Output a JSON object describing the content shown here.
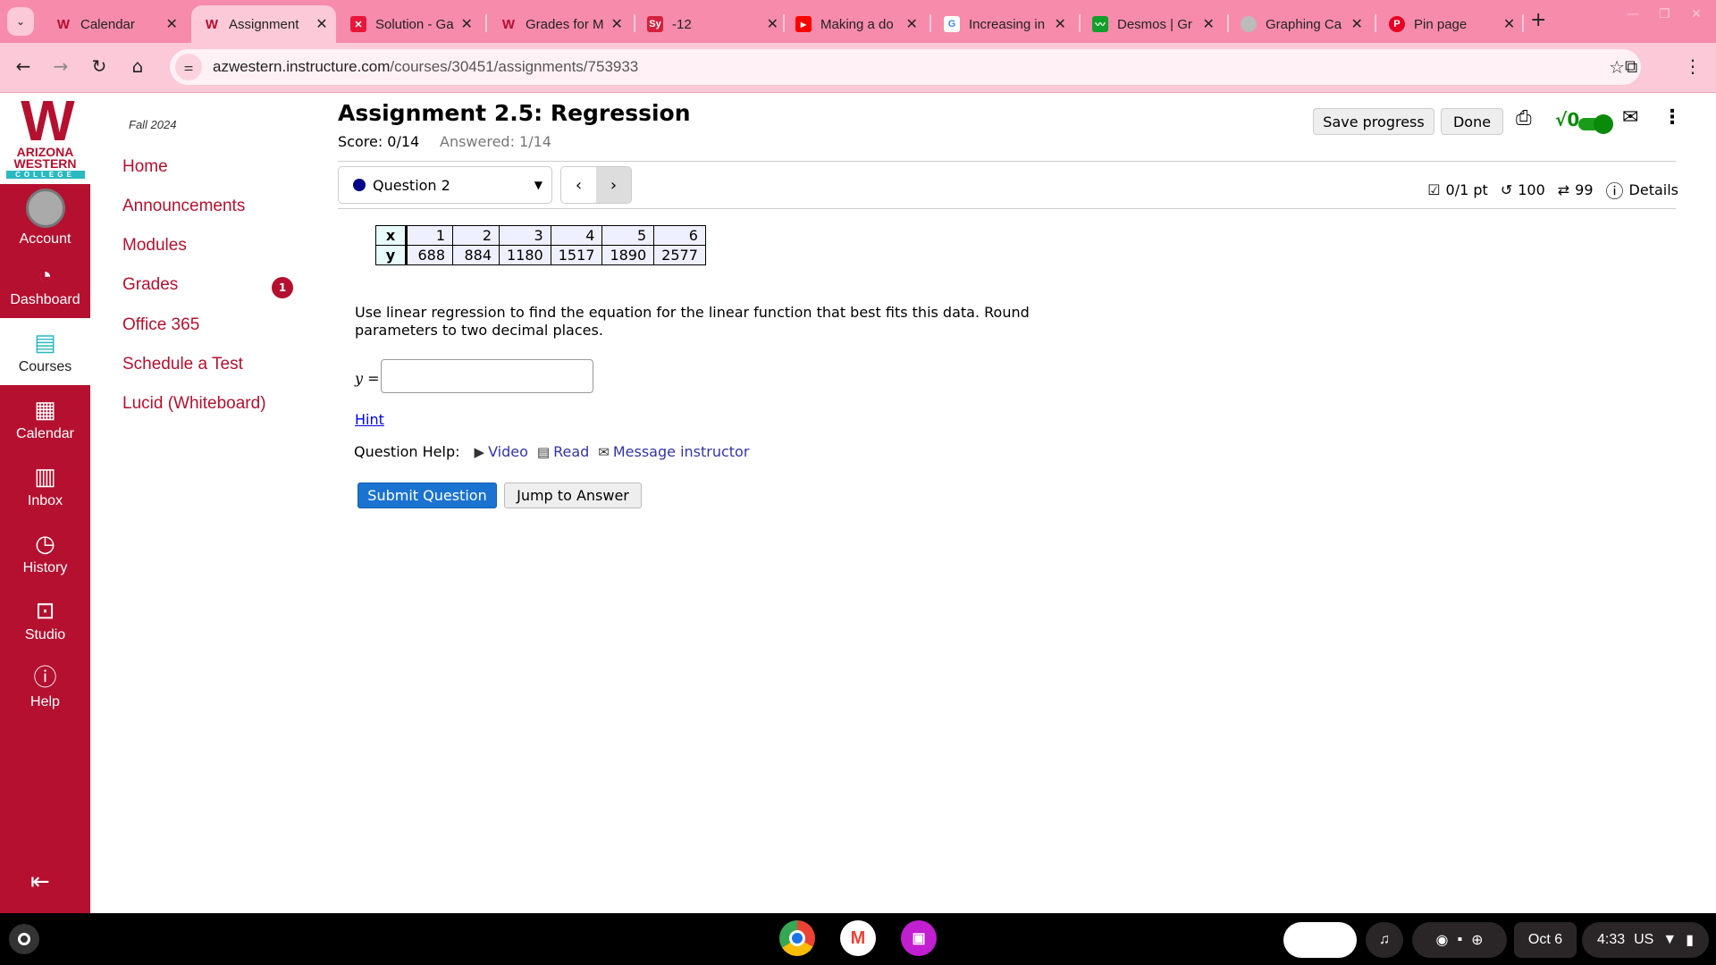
{
  "browser": {
    "tabs": [
      {
        "title": "Calendar",
        "favicon": "awc-w",
        "color": "#b5102f",
        "active": false
      },
      {
        "title": "Assignment",
        "favicon": "awc-w",
        "color": "#b5102f",
        "active": true
      },
      {
        "title": "Solution - Ga",
        "favicon": "x-logo",
        "color": "#e8163a",
        "active": false
      },
      {
        "title": "Grades for M",
        "favicon": "awc-w",
        "color": "#b5102f",
        "active": false
      },
      {
        "title": "-12",
        "favicon": "Sy",
        "color": "#d4213d",
        "active": false
      },
      {
        "title": "Making a do",
        "favicon": "youtube",
        "color": "#ff0000",
        "active": false
      },
      {
        "title": "Increasing in",
        "favicon": "G",
        "color": "#4285f4",
        "active": false
      },
      {
        "title": "Desmos | Gr",
        "favicon": "desmos",
        "color": "#129f2b",
        "active": false
      },
      {
        "title": "Graphing Ca",
        "favicon": "globe",
        "color": "#aaaaaa",
        "active": false
      },
      {
        "title": "Pin page",
        "favicon": "pinterest",
        "color": "#e60023",
        "active": false
      }
    ],
    "url_host": "azwestern.instructure.com",
    "url_path": "/courses/30451/assignments/753933"
  },
  "globalnav": {
    "logo": {
      "line1": "ARIZONA",
      "line2": "WESTERN",
      "line3": "COLLEGE"
    },
    "items": [
      {
        "label": "Account",
        "icon": "avatar-icon"
      },
      {
        "label": "Dashboard",
        "icon": "dashboard-icon"
      },
      {
        "label": "Courses",
        "icon": "courses-icon",
        "active": true
      },
      {
        "label": "Calendar",
        "icon": "calendar-icon"
      },
      {
        "label": "Inbox",
        "icon": "inbox-icon"
      },
      {
        "label": "History",
        "icon": "clock-icon"
      },
      {
        "label": "Studio",
        "icon": "studio-icon"
      },
      {
        "label": "Help",
        "icon": "help-icon"
      }
    ]
  },
  "coursenav": {
    "term": "Fall 2024",
    "items": [
      "Home",
      "Announcements",
      "Modules",
      "Grades",
      "Office 365",
      "Schedule a Test",
      "Lucid (Whiteboard)"
    ],
    "grades_badge": "1"
  },
  "assignment": {
    "title": "Assignment 2.5: Regression",
    "score": "Score: 0/14",
    "answered": "Answered: 1/14",
    "save_label": "Save progress",
    "done_label": "Done",
    "sqrt_label": "√0",
    "toggle_on": true,
    "question_select": "Question 2",
    "stats": {
      "points": "0/1 pt",
      "retries": "100",
      "attempts": "99",
      "details": "Details"
    },
    "table": {
      "x_label": "x",
      "y_label": "y",
      "x": [
        "1",
        "2",
        "3",
        "4",
        "5",
        "6"
      ],
      "y": [
        "688",
        "884",
        "1180",
        "1517",
        "1890",
        "2577"
      ]
    },
    "question_text": "Use linear regression to find the equation for the linear function that best fits this data. Round parameters to two decimal places.",
    "answer_label": "y =",
    "answer_value": "",
    "hint": "Hint",
    "help_label": "Question Help:",
    "help_links": [
      "Video",
      "Read",
      "Message instructor"
    ],
    "submit_label": "Submit Question",
    "jump_label": "Jump to Answer"
  },
  "shelf": {
    "date": "Oct 6",
    "time": "4:33",
    "locale": "US"
  }
}
